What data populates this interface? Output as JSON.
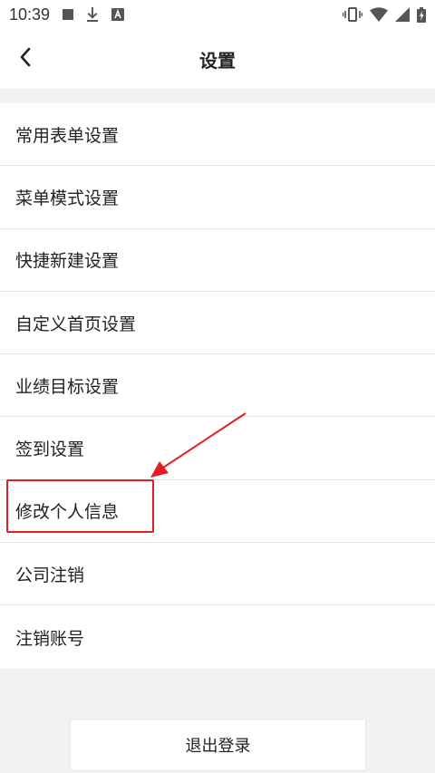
{
  "status_bar": {
    "time": "10:39",
    "left_icons": [
      "stop-square-icon",
      "download-icon",
      "text-a-icon"
    ],
    "right_icons": [
      "vibrate-icon",
      "wifi-icon",
      "signal-icon",
      "battery-charging-icon"
    ]
  },
  "header": {
    "title": "设置",
    "back_icon": "chevron-left-icon"
  },
  "menu": {
    "items": [
      {
        "label": "常用表单设置"
      },
      {
        "label": "菜单模式设置"
      },
      {
        "label": "快捷新建设置"
      },
      {
        "label": "自定义首页设置"
      },
      {
        "label": "业绩目标设置"
      },
      {
        "label": "签到设置"
      },
      {
        "label": "修改个人信息"
      },
      {
        "label": "公司注销"
      },
      {
        "label": "注销账号"
      }
    ]
  },
  "annotation": {
    "highlight_color": "#e51c23"
  },
  "logout": {
    "label": "退出登录"
  }
}
